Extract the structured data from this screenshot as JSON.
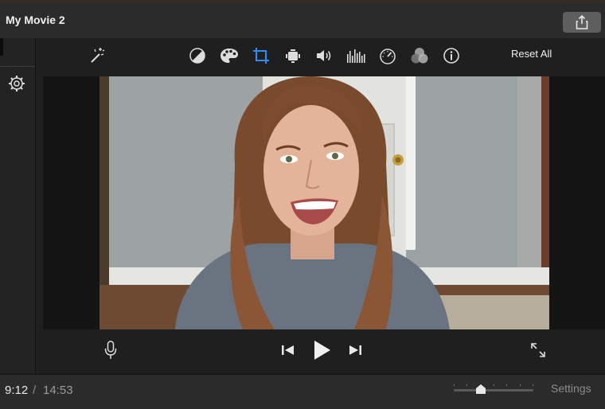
{
  "window": {
    "title": "My Movie 2"
  },
  "toolbar": {
    "tools": [
      {
        "icon": "magic-wand-icon"
      },
      {
        "icon": "color-balance-icon"
      },
      {
        "icon": "color-correction-palette-icon"
      },
      {
        "icon": "crop-icon"
      },
      {
        "icon": "stabilization-camera-icon"
      },
      {
        "icon": "volume-icon"
      },
      {
        "icon": "noise-reduction-equalizer-icon"
      },
      {
        "icon": "speed-gauge-icon"
      },
      {
        "icon": "clip-filter-icon"
      },
      {
        "icon": "info-icon"
      }
    ],
    "reset_label": "Reset All",
    "active_tool": "crop-icon",
    "accent_color": "#2f8cff"
  },
  "viewer": {
    "video_description": ""
  },
  "playback": {
    "mic": "microphone-icon",
    "prev": "skip-back-icon",
    "play": "play-icon",
    "next": "skip-forward-icon",
    "fullscreen": "fullscreen-icon"
  },
  "status": {
    "current_time": "9:12",
    "separator": "/",
    "total_time": "14:53",
    "zoom_level": 0.35,
    "settings_label": "Settings"
  }
}
